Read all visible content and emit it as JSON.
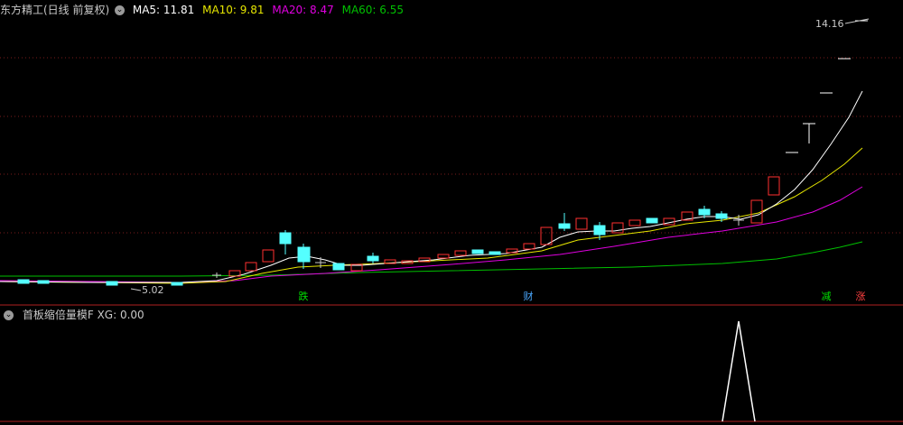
{
  "header": {
    "title": "东方精工(日线 前复权)",
    "ma5": "MA5: 11.81",
    "ma10": "MA10: 9.81",
    "ma20": "MA20: 8.47",
    "ma60": "MA60: 6.55",
    "colors": {
      "ma5": "#ffffff",
      "ma10": "#e6e600",
      "ma20": "#e000e0",
      "ma60": "#00c000"
    }
  },
  "price_labels": {
    "high": "14.16",
    "low": "5.02"
  },
  "markers": [
    {
      "text": "跌",
      "color": "#00e000"
    },
    {
      "text": "财",
      "color": "#4aa8ff"
    },
    {
      "text": "减",
      "color": "#00e000"
    },
    {
      "text": "涨",
      "color": "#ff4040"
    }
  ],
  "indicator": {
    "title": "首板缩倍量模F",
    "xg": "XG: 0.00"
  },
  "icons": {
    "settings": "chevron-down-icon"
  }
}
